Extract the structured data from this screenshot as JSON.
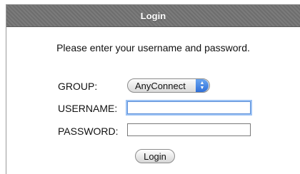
{
  "header": {
    "title": "Login"
  },
  "instructions": "Please enter your username and password.",
  "form": {
    "group_label": "GROUP:",
    "group_value": "AnyConnect",
    "username_label": "USERNAME:",
    "username_value": "",
    "password_label": "PASSWORD:",
    "password_value": "",
    "login_label": "Login"
  },
  "icons": {
    "select_arrows": "up-down-arrows-icon"
  },
  "colors": {
    "header_bg": "#757575",
    "focus_ring": "#9cc2f4",
    "select_arrow_bg": "#3a7be0"
  }
}
